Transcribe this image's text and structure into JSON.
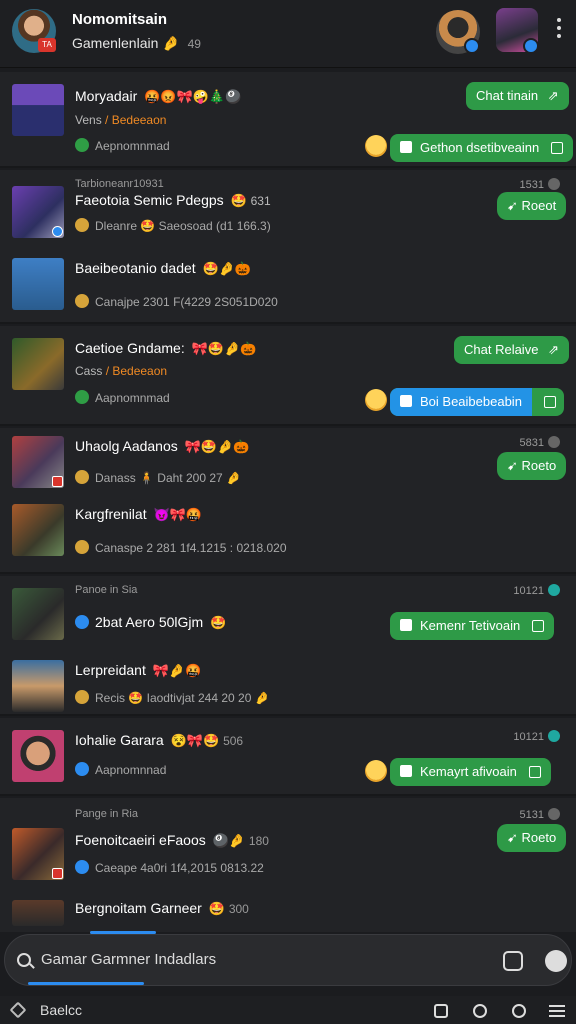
{
  "header": {
    "title": "Nomomitsain",
    "subtitle": "Gamenlenlain",
    "subtitle_emoji": "🤌",
    "subtitle_count": "49",
    "me_badge": "TA"
  },
  "colors": {
    "accent_green": "#2e9a47",
    "accent_blue": "#2393e6",
    "background": "#1b1c1f",
    "card": "#222326"
  },
  "cards": [
    {
      "name": "Moryadair",
      "emojis": "🤬😡🎀🤪🎄🎱",
      "sub_a": "Vens",
      "sub_b": "/ Bedeeaon",
      "meta": "Aepnomnmad",
      "btn_top": "Chat tinain",
      "btn_bottom": "Gethon dsetibveainn"
    },
    {
      "headline": "Tarbioneanr10931",
      "time": "1531",
      "items": [
        {
          "name": "Faeotoia",
          "name2": "Semic Pdegps",
          "emojis": "🤩",
          "count": "631",
          "meta": "Dleanre 🤩 Saeosoad (d1 166.3)"
        },
        {
          "name": "Baeibeotanio dadet",
          "emojis": "🤩🤌🎃",
          "meta": "Canajpe 2301 F(4229 2S051D020"
        }
      ],
      "btn": "Roeot"
    },
    {
      "name": "Caetioe Gndame:",
      "emojis": "🎀🤩🤌🎃",
      "sub_a": "Cass",
      "sub_b": "/ Bedeeaon",
      "meta": "Aapnomnmad",
      "btn_top": "Chat Relaive",
      "btn_bottom": "Boi Beaibebeabin"
    },
    {
      "time": "5831",
      "items": [
        {
          "name": "Uhaolg Aadanos",
          "emojis": "🎀🤩🤌🎃",
          "meta": "Danass 🧍 Daht 200 27 🤌"
        },
        {
          "name": "Kargfrenilat",
          "emojis": "😈🎀🤬",
          "meta": "Canaspe 2 281 1f4.1215 : 0218.020"
        }
      ],
      "btn": "Roeto"
    },
    {
      "headline": "Panoe in Sia",
      "time": "10121",
      "items": [
        {
          "name": "2bat Aero 50lGjm",
          "emojis": "🤩",
          "meta": ""
        },
        {
          "name": "Lerpreidant",
          "emojis": "🎀🤌🤬",
          "meta": "Recis 🤩 Iaodtivjat 244 20 20 🤌"
        }
      ],
      "btn": "Kemenr Tetivoain"
    },
    {
      "name": "Iohalie Garara",
      "emojis": "😵🎀🤩",
      "count": "506",
      "time": "10121",
      "meta": "Aapnomnnad",
      "btn": "Kemayrt afivoain"
    },
    {
      "headline": "Pange in Ria",
      "time": "5131",
      "items": [
        {
          "name": "Foenoitcaeiri eFaoos",
          "emojis": "🎱🤌",
          "count": "180",
          "meta": "Caeape 4a0ri 1f4,2015 0813.22"
        },
        {
          "name": "Bergnoitam Garneer",
          "emojis": "🤩",
          "count": "300",
          "meta": ""
        }
      ],
      "btn": "Roeto"
    }
  ],
  "search": {
    "placeholder": "Gamar Garmner Indadlars"
  },
  "bottom": {
    "label": "Baelcc"
  }
}
